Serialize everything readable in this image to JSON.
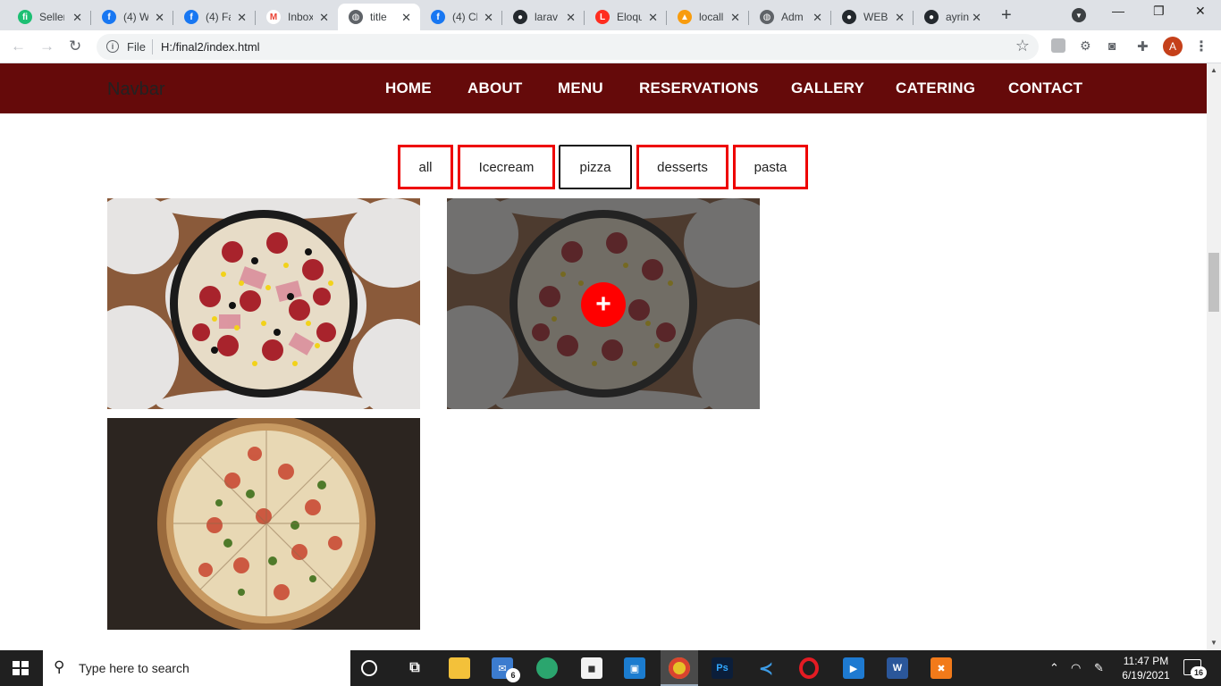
{
  "browser": {
    "tabs": [
      {
        "title": "Seller",
        "icon": "fiverr-icon",
        "color": "#1dbf73",
        "glyph": "fi"
      },
      {
        "title": "(4) W",
        "icon": "facebook-icon",
        "color": "#1877f2",
        "glyph": "f"
      },
      {
        "title": "(4) Fa",
        "icon": "facebook-icon",
        "color": "#1877f2",
        "glyph": "f"
      },
      {
        "title": "Inbox",
        "icon": "gmail-icon",
        "color": "#ea4335",
        "glyph": "M"
      },
      {
        "title": "title",
        "icon": "globe-icon",
        "color": "#5f6368",
        "glyph": "◍",
        "active": true
      },
      {
        "title": "(4) Cl",
        "icon": "facebook-icon",
        "color": "#1877f2",
        "glyph": "f"
      },
      {
        "title": "larav",
        "icon": "github-icon",
        "color": "#24292e",
        "glyph": "●"
      },
      {
        "title": "Eloqu",
        "icon": "laravel-icon",
        "color": "#ff2d20",
        "glyph": "L"
      },
      {
        "title": "locall",
        "icon": "phpmyadmin-icon",
        "color": "#f89c0e",
        "glyph": "▲"
      },
      {
        "title": "Adm",
        "icon": "globe-icon",
        "color": "#5f6368",
        "glyph": "◍"
      },
      {
        "title": "WEB",
        "icon": "github-icon",
        "color": "#24292e",
        "glyph": "●"
      },
      {
        "title": "ayrin",
        "icon": "github-icon",
        "color": "#24292e",
        "glyph": "●"
      }
    ],
    "address": {
      "file_label": "File",
      "url": "H:/final2/index.html"
    },
    "profile_initial": "A"
  },
  "navbar": {
    "brand": "Navbar",
    "links": [
      "HOME",
      "ABOUT",
      "MENU",
      "RESERVATIONS",
      "GALLERY",
      "CATERING",
      "CONTACT"
    ]
  },
  "filters": {
    "items": [
      "all",
      "Icecream",
      "pizza",
      "desserts",
      "pasta"
    ],
    "active": "pizza"
  },
  "gallery": {
    "items": [
      {
        "name": "pizza-toppings-photo",
        "hovered": false
      },
      {
        "name": "pizza-toppings-photo",
        "hovered": true,
        "action_glyph": "+"
      },
      {
        "name": "pizza-wood-board-photo",
        "hovered": false
      }
    ]
  },
  "taskbar": {
    "search_placeholder": "Type here to search",
    "mail_badge": "6",
    "time": "11:47 PM",
    "date": "6/19/2021",
    "notification_count": "16"
  },
  "colors": {
    "navbar_bg": "#650a0a",
    "filter_border": "#ee0000",
    "plus_button": "#ff0000"
  }
}
